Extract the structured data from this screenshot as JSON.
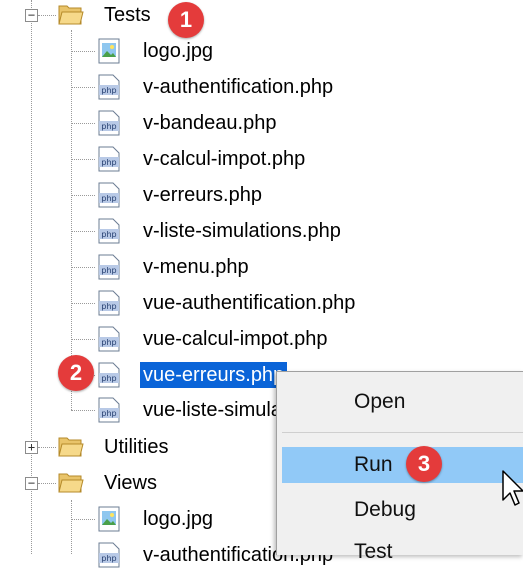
{
  "tree": {
    "folders": [
      {
        "label": "Tests",
        "toggle": "−"
      },
      {
        "label": "Utilities",
        "toggle": "+"
      },
      {
        "label": "Views",
        "toggle": "−"
      }
    ],
    "tests_files": [
      "logo.jpg",
      "v-authentification.php",
      "v-bandeau.php",
      "v-calcul-impot.php",
      "v-erreurs.php",
      "v-liste-simulations.php",
      "v-menu.php",
      "vue-authentification.php",
      "vue-calcul-impot.php",
      "vue-erreurs.php",
      "vue-liste-simulations.php"
    ],
    "views_files": [
      "logo.jpg",
      "v-authentification.php"
    ],
    "selected_file": "vue-erreurs.php"
  },
  "context_menu": {
    "items": [
      "Open",
      "Run",
      "Debug",
      "Test"
    ],
    "highlighted": "Run"
  },
  "badges": [
    "1",
    "2",
    "3"
  ],
  "colors": {
    "selection": "#0a64d8",
    "menu_highlight": "#91c9f7",
    "badge": "#e43b3b"
  }
}
